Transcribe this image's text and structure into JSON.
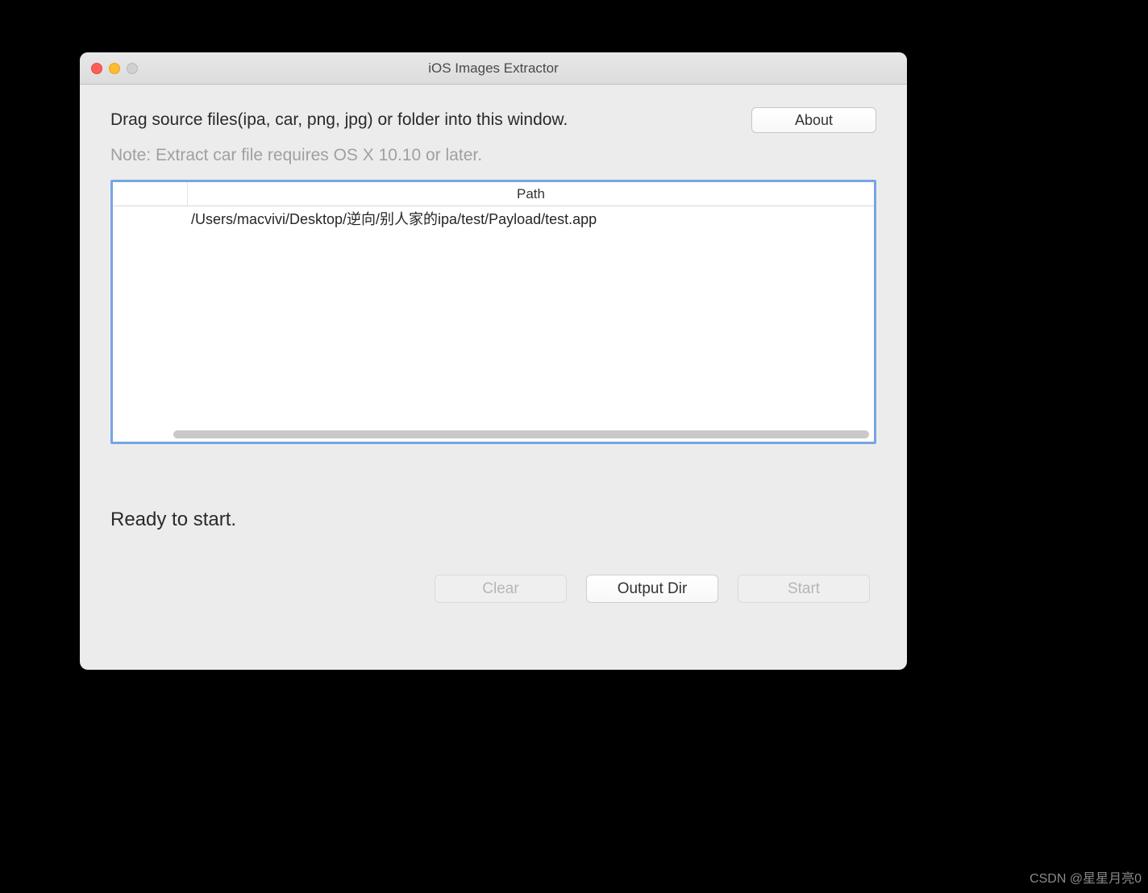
{
  "window": {
    "title": "iOS Images Extractor"
  },
  "header": {
    "instruction": "Drag source files(ipa, car, png, jpg) or folder into this window.",
    "about_label": "About",
    "note": "Note: Extract car file requires OS X 10.10 or later."
  },
  "table": {
    "columns": {
      "path": "Path"
    },
    "rows": [
      {
        "path": "/Users/macvivi/Desktop/逆向/别人家的ipa/test/Payload/test.app"
      }
    ]
  },
  "status": "Ready to start.",
  "buttons": {
    "clear": "Clear",
    "output_dir": "Output Dir",
    "start": "Start"
  },
  "watermark": "CSDN @星星月亮0"
}
